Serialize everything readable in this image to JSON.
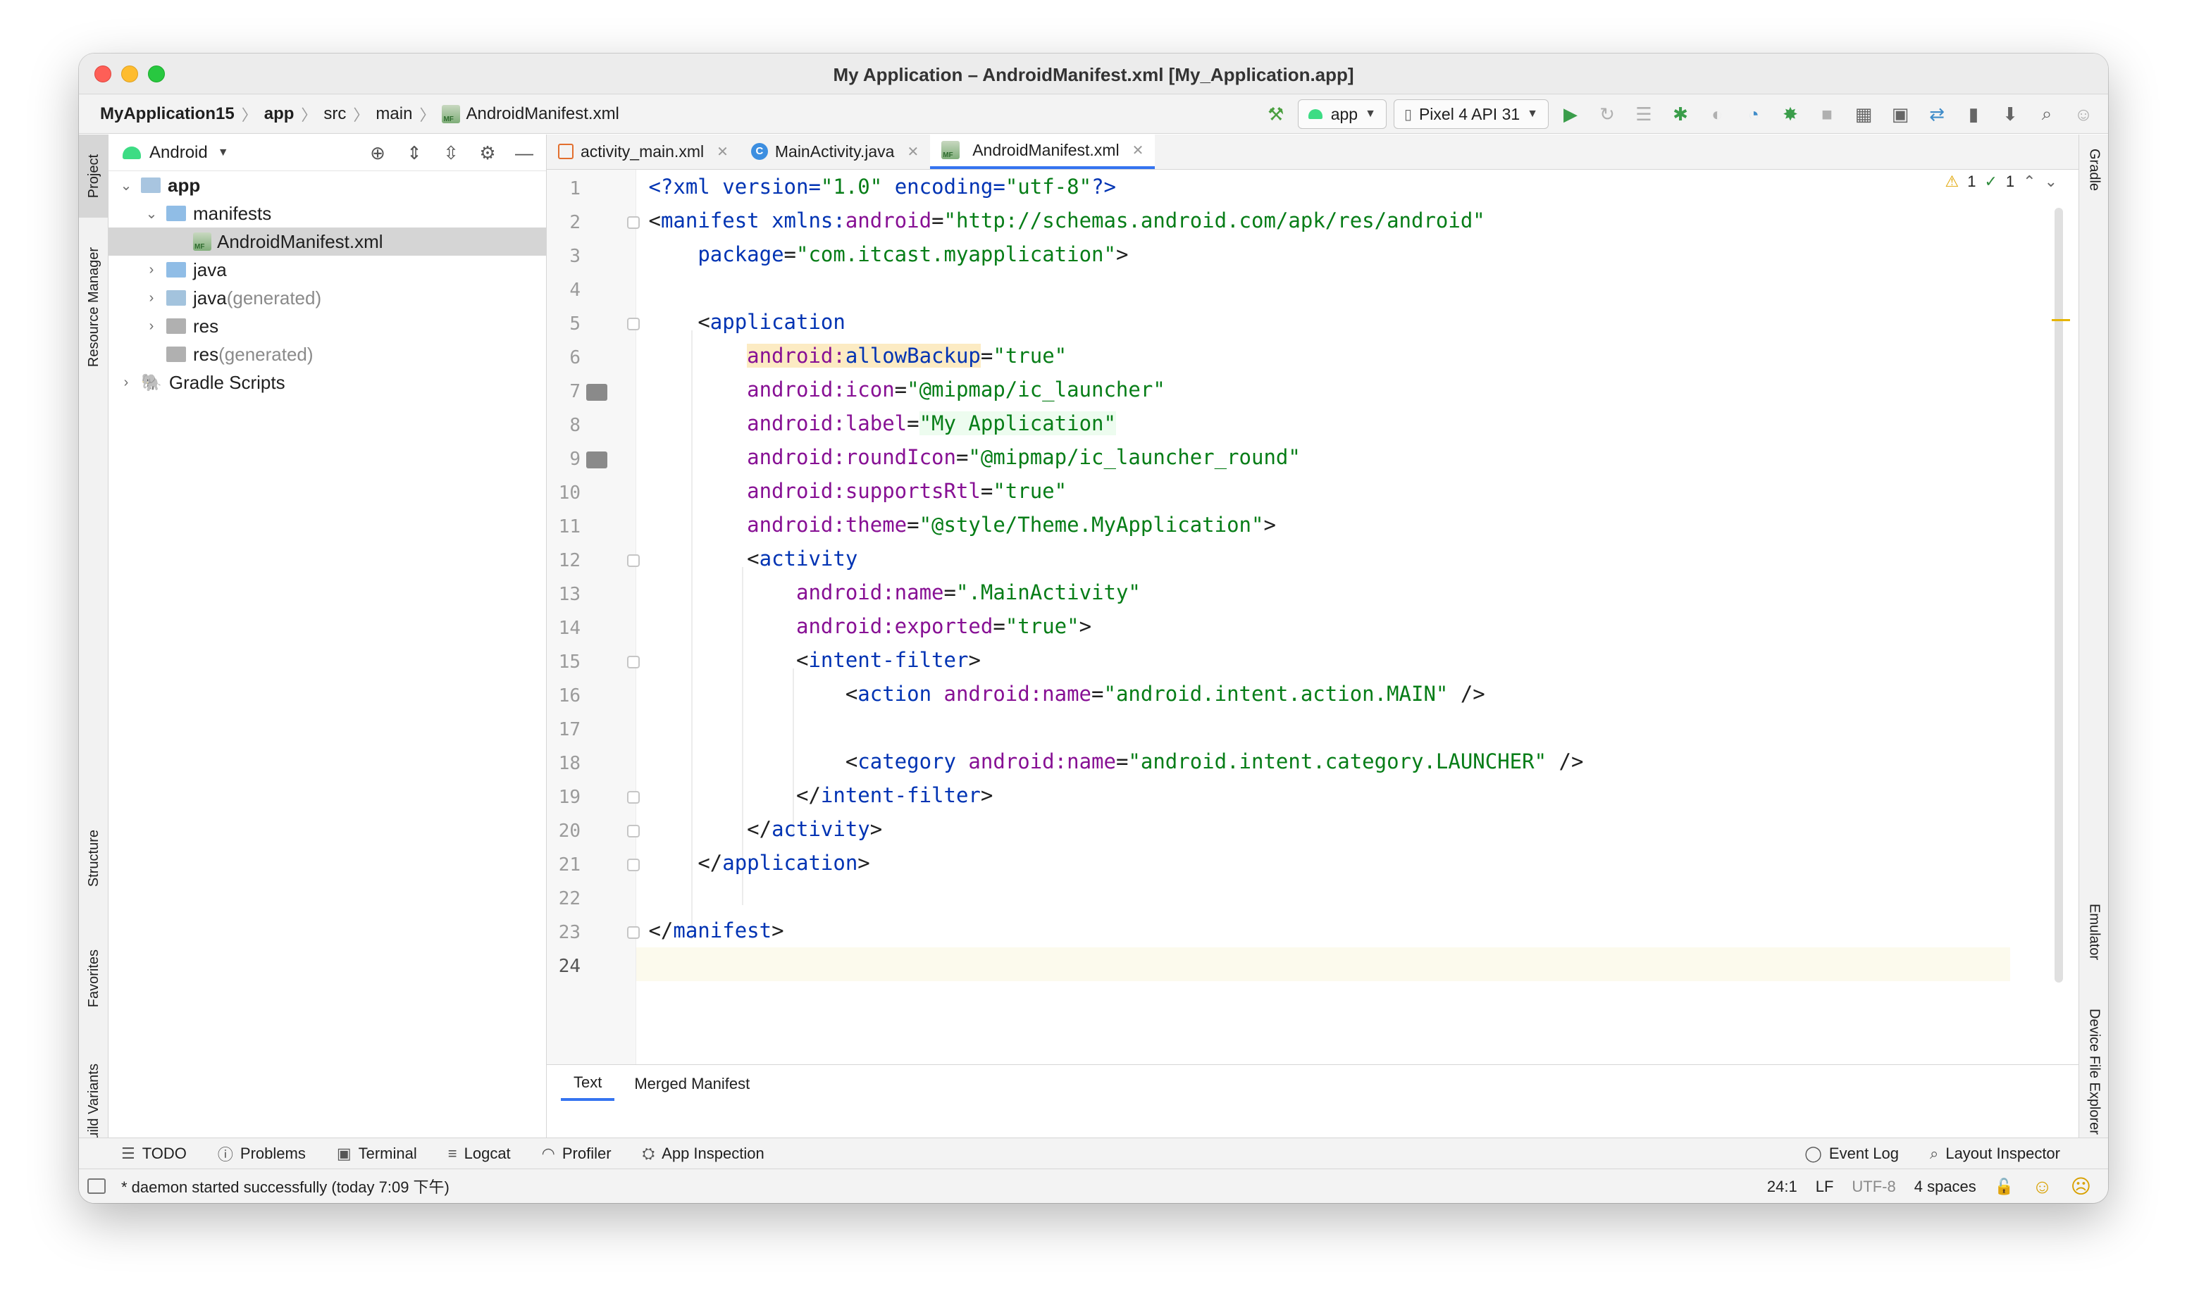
{
  "window": {
    "title": "My Application – AndroidManifest.xml [My_Application.app]"
  },
  "breadcrumbs": [
    "MyApplication15",
    "app",
    "src",
    "main",
    "AndroidManifest.xml"
  ],
  "toolbar": {
    "run_config": "app",
    "device": "Pixel 4 API 31",
    "icons": [
      "hammer-icon",
      "run-icon",
      "rerun-icon",
      "list-icon",
      "debug-icon",
      "attach-icon",
      "profile-icon",
      "bug-icon",
      "stop-icon",
      "project-structure-icon",
      "terminal-icon",
      "sync-icon",
      "avd-icon",
      "sdk-icon",
      "search-icon",
      "user-icon"
    ]
  },
  "left_strip": {
    "project": "Project",
    "resource_manager": "Resource Manager",
    "structure": "Structure",
    "favorites": "Favorites",
    "build_variants": "Build Variants"
  },
  "right_strip": {
    "gradle": "Gradle",
    "emulator": "Emulator",
    "device_file_explorer": "Device File Explorer"
  },
  "project_panel": {
    "view": "Android",
    "tree": [
      {
        "label": "app",
        "suffix": ""
      },
      {
        "label": "manifests",
        "suffix": ""
      },
      {
        "label": "AndroidManifest.xml",
        "suffix": ""
      },
      {
        "label": "java",
        "suffix": ""
      },
      {
        "label": "java",
        "suffix": " (generated)"
      },
      {
        "label": "res",
        "suffix": ""
      },
      {
        "label": "res",
        "suffix": " (generated)"
      },
      {
        "label": "Gradle Scripts",
        "suffix": ""
      }
    ]
  },
  "editor_tabs": [
    "activity_main.xml",
    "MainActivity.java",
    "AndroidManifest.xml"
  ],
  "inspections": {
    "warnings": "1",
    "checks": "1"
  },
  "line_numbers": [
    "1",
    "2",
    "3",
    "4",
    "5",
    "6",
    "7",
    "8",
    "9",
    "10",
    "11",
    "12",
    "13",
    "14",
    "15",
    "16",
    "17",
    "18",
    "19",
    "20",
    "21",
    "22",
    "23",
    "24"
  ],
  "code": {
    "l1": {
      "a": "<?",
      "b": "xml version",
      "c": "=",
      "d": "\"1.0\"",
      "e": " encoding",
      "f": "=",
      "g": "\"utf-8\"",
      "h": "?>"
    },
    "l2": {
      "a": "<",
      "b": "manifest",
      "c": " xmlns:",
      "d": "android",
      "e": "=",
      "f": "\"http://schemas.android.com/apk/res/android\""
    },
    "l3": {
      "a": "package",
      "b": "=",
      "c": "\"com.itcast.myapplication\"",
      "d": ">"
    },
    "l5": {
      "a": "<",
      "b": "application"
    },
    "l6": {
      "a": "android:",
      "b": "allowBackup",
      "c": "=",
      "d": "\"true\""
    },
    "l7": {
      "a": "android:icon",
      "b": "=",
      "c": "\"@mipmap/ic_launcher\""
    },
    "l8": {
      "a": "android:label",
      "b": "=",
      "c": "\"My Application\""
    },
    "l9": {
      "a": "android:roundIcon",
      "b": "=",
      "c": "\"@mipmap/ic_launcher_round\""
    },
    "l10": {
      "a": "android:supportsRtl",
      "b": "=",
      "c": "\"true\""
    },
    "l11": {
      "a": "android:theme",
      "b": "=",
      "c": "\"@style/Theme.MyApplication\"",
      "d": ">"
    },
    "l12": {
      "a": "<",
      "b": "activity"
    },
    "l13": {
      "a": "android:name",
      "b": "=",
      "c": "\".MainActivity\""
    },
    "l14": {
      "a": "android:exported",
      "b": "=",
      "c": "\"true\"",
      "d": ">"
    },
    "l15": {
      "a": "<",
      "b": "intent-filter",
      "c": ">"
    },
    "l16": {
      "a": "<",
      "b": "action",
      "c": " android:name",
      "d": "=",
      "e": "\"android.intent.action.MAIN\"",
      "f": " />"
    },
    "l18": {
      "a": "<",
      "b": "category",
      "c": " android:name",
      "d": "=",
      "e": "\"android.intent.category.LAUNCHER\"",
      "f": " />"
    },
    "l19": {
      "a": "</",
      "b": "intent-filter",
      "c": ">"
    },
    "l20": {
      "a": "</",
      "b": "activity",
      "c": ">"
    },
    "l21": {
      "a": "</",
      "b": "application",
      "c": ">"
    },
    "l23": {
      "a": "</",
      "b": "manifest",
      "c": ">"
    }
  },
  "bottom_tabs": [
    "Text",
    "Merged Manifest"
  ],
  "tool_windows": {
    "left": [
      "TODO",
      "Problems",
      "Terminal",
      "Logcat",
      "Profiler",
      "App Inspection"
    ],
    "right": [
      "Event Log",
      "Layout Inspector"
    ]
  },
  "status": {
    "message": "* daemon started successfully (today 7:09 下午)",
    "position": "24:1",
    "line_sep": "LF",
    "encoding": "UTF-8",
    "indent": "4 spaces"
  },
  "colors": {
    "tag": "#0033b3",
    "attr": "#871094",
    "value": "#067d17",
    "accent": "#3574f0"
  }
}
